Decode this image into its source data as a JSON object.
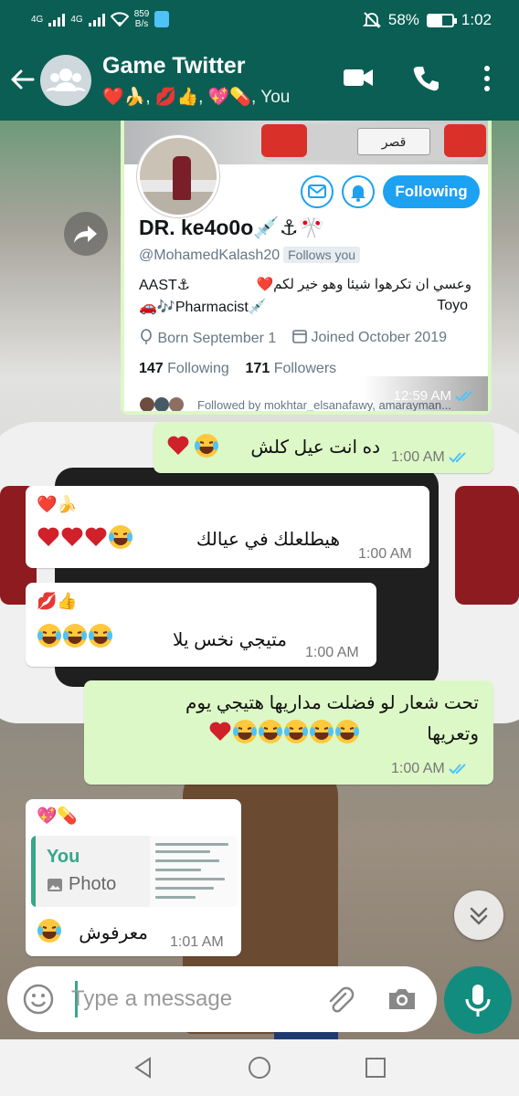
{
  "status_bar": {
    "net_label_1": "4G",
    "net_label_2": "4G",
    "speed": "859",
    "speed_unit": "B/s",
    "battery": "58%",
    "battery_level": 0.58,
    "time": "1:02"
  },
  "header": {
    "title": "Game Twitter",
    "participants": "❤️🍌, 💋👍, 💖💊, You"
  },
  "shared_image": {
    "plate": "قصر",
    "profile_name": "DR. ke4o0o💉⚓🎌",
    "handle": "@MohamedKalash20",
    "follows_you": "Follows you",
    "bio_left_1": "AAST⚓",
    "bio_right_1": "وعسي ان تكرهوا شيئا وهو خير لكم❤️",
    "bio_left_2": "🚗🎶Pharmacist💉",
    "bio_right_2": "Toyo",
    "born": "Born September 1",
    "joined": "Joined October 2019",
    "following_count": "147",
    "following_label": "Following",
    "followers_count": "171",
    "followers_label": "Followers",
    "followed_by": "Followed by mokhtar_elsanafawy, amarayman...",
    "following_button": "Following",
    "time": "12:59 AM"
  },
  "messages": [
    {
      "id": "m1",
      "direction": "out",
      "text": "ده انت عيل كلش",
      "time": "1:00 AM"
    },
    {
      "id": "m2",
      "direction": "in",
      "sender": "❤️🍌",
      "text": "هيطلعلك في عيالك",
      "time": "1:00 AM"
    },
    {
      "id": "m3",
      "direction": "in",
      "sender": "💋👍",
      "text": "متيجي نخس يلا",
      "time": "1:00 AM"
    },
    {
      "id": "m4",
      "direction": "out",
      "line1": "تحت شعار لو فضلت مداريها هتيجي يوم",
      "line2": "وتعريها",
      "time": "1:00 AM"
    },
    {
      "id": "m5",
      "direction": "in",
      "sender": "💖💊",
      "quote_author": "You",
      "quote_type": "Photo",
      "text": "معرفوش",
      "time": "1:01 AM"
    }
  ],
  "composer": {
    "placeholder": "Type a message"
  },
  "icons": {
    "back": "arrow-left-icon",
    "avatar": "group-avatar-icon",
    "video": "video-call-icon",
    "call": "phone-icon",
    "menu": "more-vert-icon",
    "forward": "forward-icon",
    "emoji": "emoji-icon",
    "attach": "paperclip-icon",
    "camera": "camera-icon",
    "mic": "mic-icon",
    "scroll": "double-chevron-down-icon"
  },
  "colors": {
    "header": "#0b5e54",
    "outgoing_bubble": "#dcf8c6",
    "incoming_bubble": "#ffffff",
    "accent": "#128c7e",
    "twitter_blue": "#1da1f2",
    "read_ticks": "#4fc3f7"
  }
}
